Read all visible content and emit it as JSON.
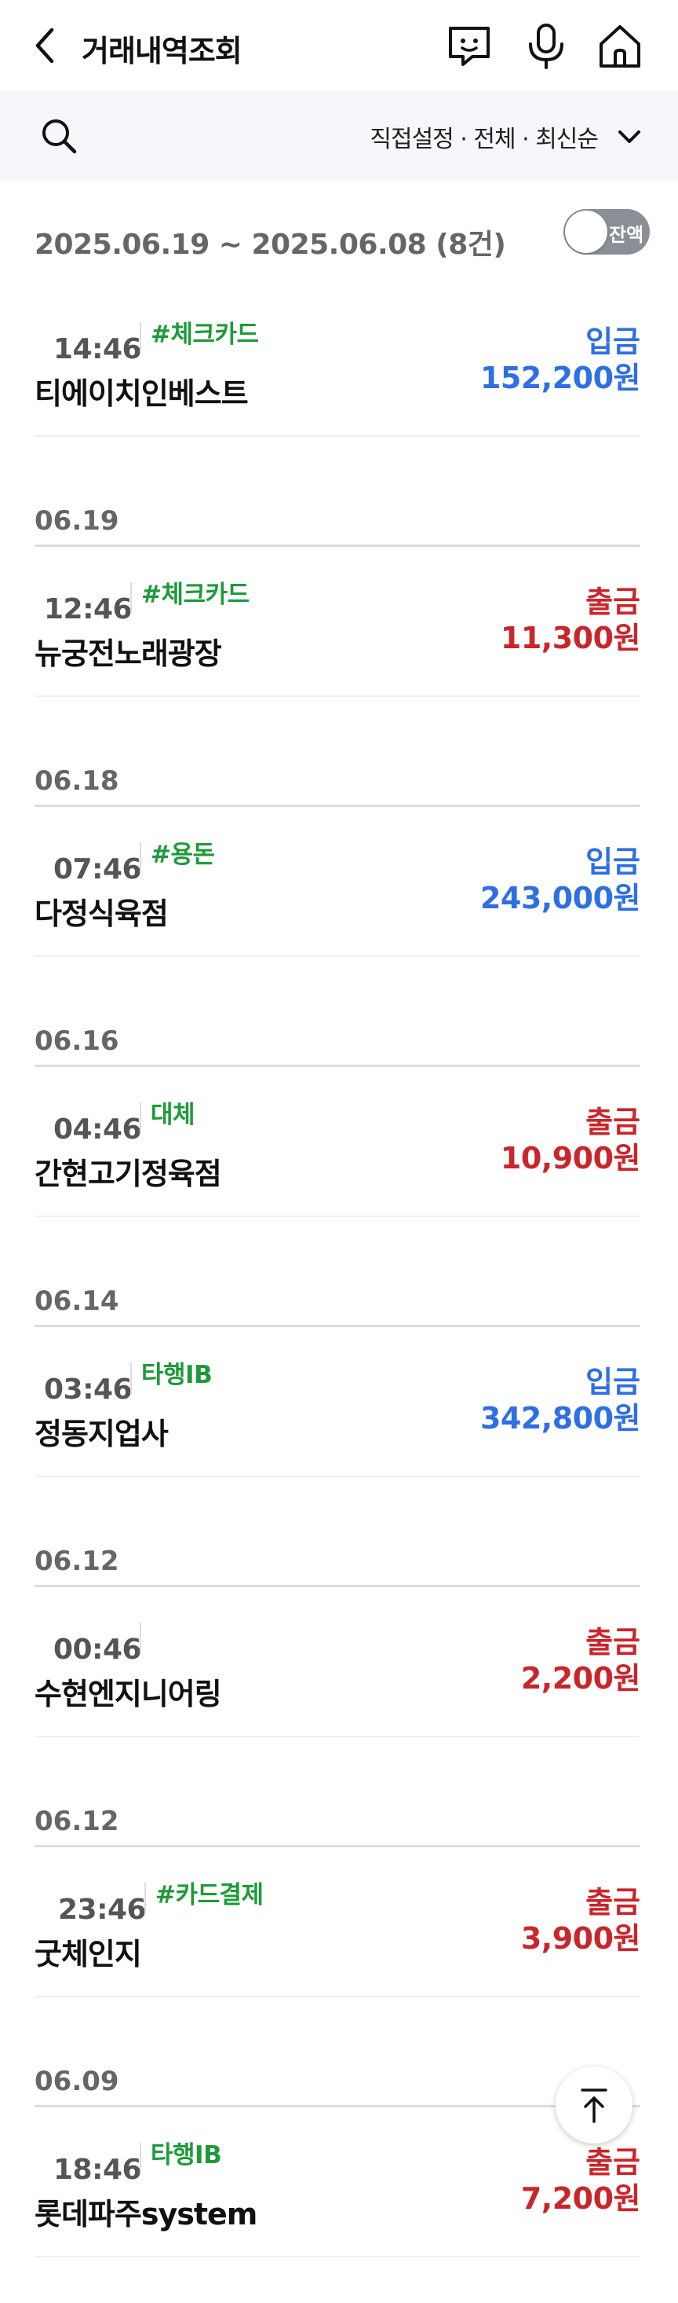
{
  "header": {
    "title": "거래내역조회"
  },
  "filter": {
    "summary": "직접설정 · 전체 · 최신순"
  },
  "range": {
    "text": "2025.06.19 ~ 2025.06.08 (8건)"
  },
  "balance_toggle": {
    "label": "잔액",
    "on": false
  },
  "transactions": [
    {
      "time": "14:46",
      "tag": "#체크카드",
      "name": "티에이치인베스트",
      "type": "입금",
      "amount": "152,200원",
      "direction": "in"
    },
    {
      "date": "06.19",
      "time": "12:46",
      "tag": "#체크카드",
      "name": "뉴궁전노래광장",
      "type": "출금",
      "amount": "11,300원",
      "direction": "out"
    },
    {
      "date": "06.18",
      "time": "07:46",
      "tag": "#용돈",
      "name": "다정식육점",
      "type": "입금",
      "amount": "243,000원",
      "direction": "in"
    },
    {
      "date": "06.16",
      "time": "04:46",
      "tag": "대체",
      "name": "간현고기정육점",
      "type": "출금",
      "amount": "10,900원",
      "direction": "out"
    },
    {
      "date": "06.14",
      "time": "03:46",
      "tag": "타행IB",
      "name": "정동지업사",
      "type": "입금",
      "amount": "342,800원",
      "direction": "in"
    },
    {
      "date": "06.12",
      "time": "00:46",
      "tag": "",
      "name": "수현엔지니어링",
      "type": "출금",
      "amount": "2,200원",
      "direction": "out"
    },
    {
      "date": "06.12",
      "time": "23:46",
      "tag": "#카드결제",
      "name": "굿체인지",
      "type": "출금",
      "amount": "3,900원",
      "direction": "out"
    },
    {
      "date": "06.09",
      "time": "18:46",
      "tag": "타행IB",
      "name": "롯데파주system",
      "type": "출금",
      "amount": "7,200원",
      "direction": "out"
    }
  ],
  "colors": {
    "in": "#2f6fe4",
    "out": "#c9262c",
    "tag": "#1e9a3a",
    "filter_bg": "#f5f7fa"
  },
  "icons": [
    "back-arrow-icon",
    "chatbot-icon",
    "microphone-icon",
    "home-icon",
    "search-icon",
    "chevron-down-icon",
    "arrow-up-icon"
  ]
}
